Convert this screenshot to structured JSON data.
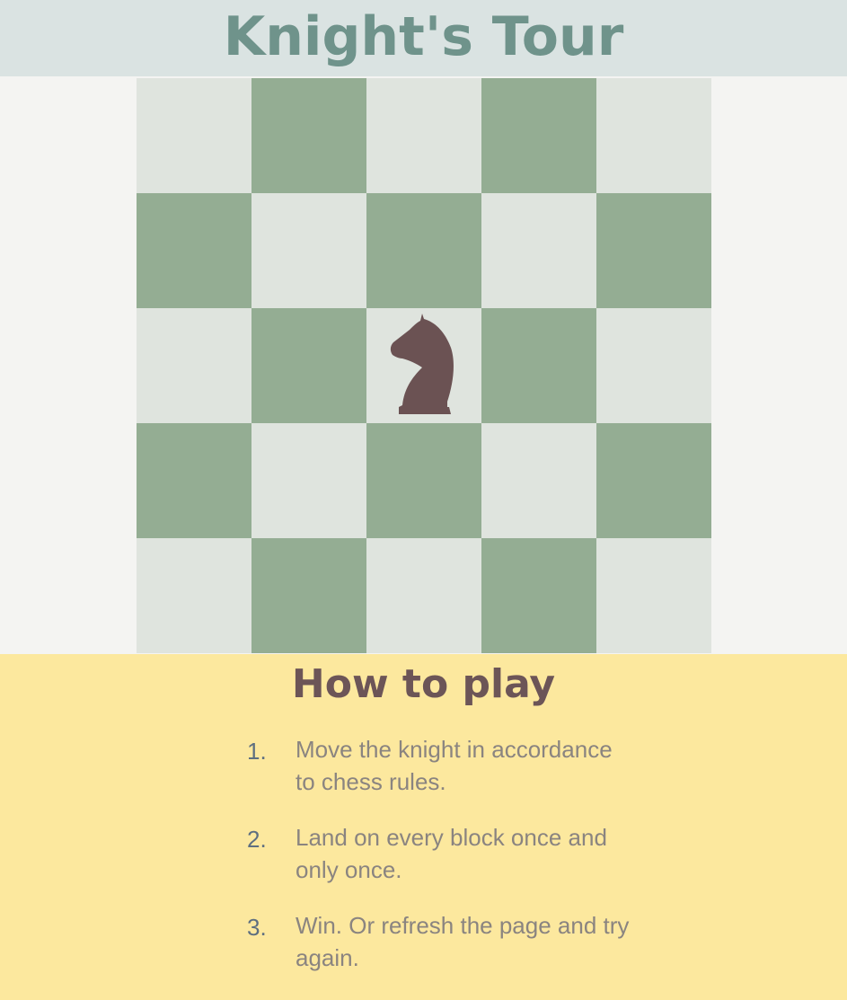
{
  "title": "Knight's Tour",
  "board": {
    "rows": 5,
    "cols": 5,
    "light_color": "#dfe4de",
    "dark_color": "#94ad93",
    "knight_position": {
      "row": 3,
      "col": 3
    },
    "knight_icon": "knight-icon",
    "knight_color": "#6b5253"
  },
  "howto": {
    "title": "How to play",
    "steps": [
      {
        "num": "1.",
        "text": "Move the knight in accordance to chess rules."
      },
      {
        "num": "2.",
        "text": "Land on every block once and only once."
      },
      {
        "num": "3.",
        "text": "Win. Or refresh the page and try again."
      }
    ]
  },
  "colors": {
    "header_bg": "#dae3e2",
    "title": "#6f938b",
    "howto_bg": "#fce89e",
    "howto_title": "#6c5557"
  }
}
